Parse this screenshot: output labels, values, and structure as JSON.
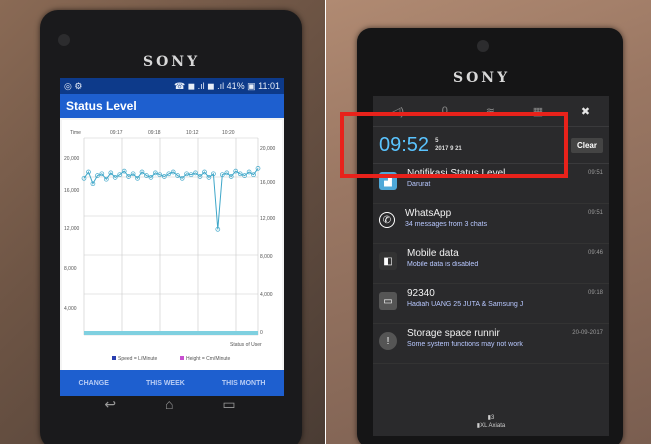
{
  "left": {
    "brand": "SONY",
    "status_bar": {
      "left": "◎ ⚙",
      "right": "☎ ◼ .ıl ◼ .ıl 41% ▣ 11:01"
    },
    "app_title": "Status Level",
    "chart_top_labels": [
      "Time",
      "09:17",
      "09:18",
      "10:12",
      "10:20"
    ],
    "y_left_ticks": [
      "20,000",
      "16,000",
      "12,000",
      "8,000",
      "4,000"
    ],
    "y_right_ticks": [
      "20,000",
      "16,000",
      "12,000",
      "8,000",
      "4,000",
      "0"
    ],
    "x_axis_note": "Status of User",
    "legend": [
      "Speed = L/Minute",
      "Height = Cm/Minute"
    ],
    "tabs": [
      "CHANGE",
      "THIS WEEK",
      "THIS MONTH"
    ],
    "nav": [
      "↩",
      "⌂",
      "▭"
    ],
    "colors": {
      "status_bar": "#0d3a8a",
      "app_bar": "#1e5fcf",
      "series": "#3fa7c9"
    }
  },
  "right": {
    "brand": "SONY",
    "quick_settings": [
      "◁)",
      "0",
      "≋",
      "▦",
      "✖"
    ],
    "clock": "09:52",
    "date_line1": "5",
    "date_line2": "2017 9 21",
    "clear_label": "Clear",
    "notifications": [
      {
        "title": "Notifikasi Status Level",
        "sub": "Darurat",
        "time": "09:51",
        "icon": "level-app-icon",
        "icon_color": "#4ea8d8"
      },
      {
        "title": "WhatsApp",
        "sub": "34 messages from 3 chats",
        "time": "09:51",
        "icon": "whatsapp-icon",
        "icon_color": "#2a2a2c"
      },
      {
        "title": "Mobile data",
        "sub": "Mobile data is disabled",
        "time": "09:46",
        "icon": "mobile-data-icon",
        "icon_color": "#333"
      },
      {
        "title": "92340",
        "sub": "Hadiah UANG 25 JUTA & Samsung J",
        "time": "09:18",
        "icon": "sms-icon",
        "icon_color": "#555"
      },
      {
        "title": "Storage space runnir",
        "sub": "Some system functions may not work",
        "time": "20-09-2017",
        "icon": "storage-warning-icon",
        "icon_color": "#555"
      }
    ],
    "carrier_lines": [
      "▮3",
      "▮XL Axiata"
    ]
  },
  "chart_data": {
    "type": "line",
    "title": "",
    "xlabel": "Status of User",
    "ylabel": "",
    "ylim": [
      0,
      22000
    ],
    "series": [
      {
        "name": "Speed = L/Minute",
        "values": [
          17500,
          18200,
          16900,
          17800,
          18000,
          17400,
          18100,
          17600,
          17900,
          18300,
          17700,
          18000,
          17500,
          18200,
          17800,
          17600,
          18100,
          17900,
          17700,
          18000,
          18200,
          17800,
          17500,
          18000,
          17900,
          18100,
          17700,
          18200,
          17600,
          18000,
          11800,
          17900,
          18100,
          17700,
          18300,
          18000,
          17800,
          18200,
          17900,
          18600
        ]
      }
    ],
    "legend_entries": [
      "Speed = L/Minute",
      "Height = Cm/Minute"
    ]
  }
}
